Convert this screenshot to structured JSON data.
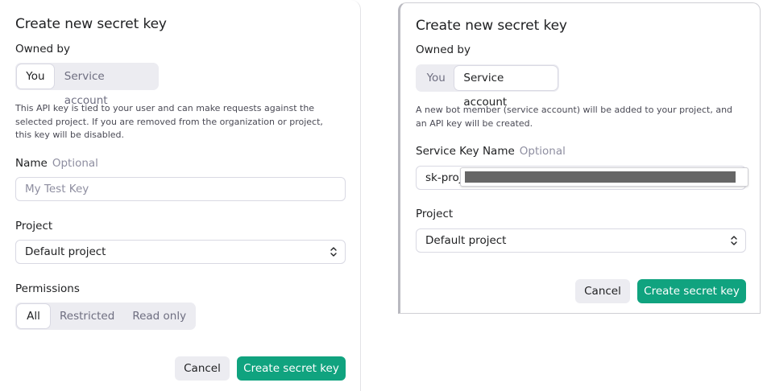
{
  "left_dialog": {
    "title": "Create new secret key",
    "owned_by_label": "Owned by",
    "owner_options": [
      "You",
      "Service account"
    ],
    "owner_selected": "You",
    "description": "This API key is tied to your user and can make requests against the selected project. If you are removed from the organization or project, this key will be disabled.",
    "name_label": "Name",
    "name_optional": "Optional",
    "name_placeholder": "My Test Key",
    "project_label": "Project",
    "project_value": "Default project",
    "permissions_label": "Permissions",
    "permission_options": [
      "All",
      "Restricted",
      "Read only"
    ],
    "permission_selected": "All",
    "cancel_label": "Cancel",
    "create_label": "Create secret key"
  },
  "right_dialog": {
    "title": "Create new secret key",
    "owned_by_label": "Owned by",
    "owner_options": [
      "You",
      "Service account"
    ],
    "owner_selected": "Service account",
    "description": "A new bot member (service account) will be added to your project, and an API key will be created.",
    "key_name_label": "Service Key Name",
    "key_name_optional": "Optional",
    "key_name_value": "sk-proj",
    "project_label": "Project",
    "project_value": "Default project",
    "cancel_label": "Cancel",
    "create_label": "Create secret key"
  },
  "colors": {
    "primary": "#10a37f",
    "segment_bg": "#ececf1",
    "muted_text": "#8e8ea0",
    "redaction": "#666666"
  },
  "icons": {
    "select_chevron": "chevron-up-down-icon"
  }
}
